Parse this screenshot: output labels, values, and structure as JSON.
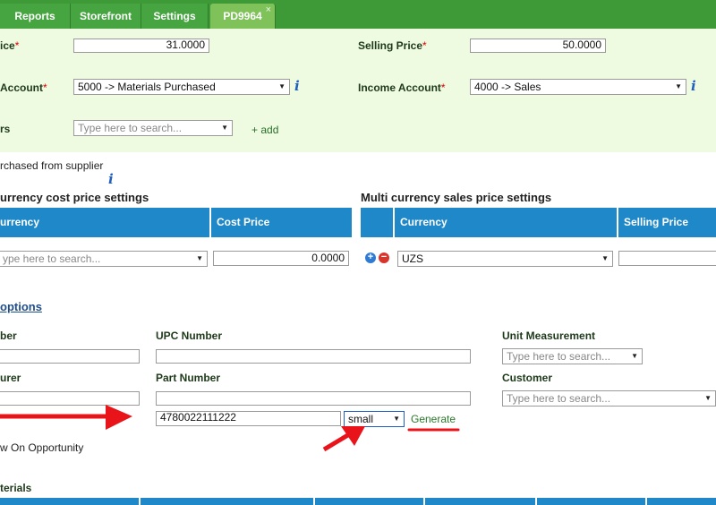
{
  "tabs": [
    {
      "label": "Reports"
    },
    {
      "label": "Storefront"
    },
    {
      "label": "Settings"
    },
    {
      "label": "PD9964",
      "active": true,
      "close": "×"
    }
  ],
  "form": {
    "cost_price_label": "ice",
    "cost_price_value": "31.0000",
    "selling_price_label": "Selling Price",
    "selling_price_value": "50.0000",
    "required_mark": "*",
    "expense_account_label": "Account",
    "expense_account_value": "5000 -> Materials Purchased",
    "income_account_label": "Income Account",
    "income_account_value": "4000 -> Sales",
    "suppliers_label": "rs",
    "suppliers_placeholder": "Type here to search...",
    "add_label": "+ add",
    "purchased_from_supplier": "rchased from supplier",
    "info_glyph": "i"
  },
  "multi_cost": {
    "title": "urrency cost price settings",
    "col_currency": "urrency",
    "col_cost_price": "Cost Price",
    "currency_placeholder": "ype here to search...",
    "cost_value": "0.0000"
  },
  "multi_sales": {
    "title": "Multi currency sales price settings",
    "col_currency": "Currency",
    "col_selling_price": "Selling Price",
    "currency_value": "UZS"
  },
  "options": {
    "link": "options",
    "number_label": "ber",
    "upc_label": "UPC Number",
    "unit_label": "Unit Measurement",
    "unit_placeholder": "Type here to search...",
    "manufacturer_label": "urer",
    "part_label": "Part Number",
    "customer_label": "Customer",
    "customer_placeholder": "Type here to search...",
    "barcode_value": "4780022111222",
    "size_value": "small",
    "generate_label": "Generate",
    "show_on_opportunity": "w On Opportunity",
    "materials_label": "terials"
  },
  "colors": {
    "tab_green": "#3d9a37",
    "panel_bg": "#eefbe0",
    "table_header_blue": "#1f88c8",
    "annotation_red": "#e8141a"
  }
}
